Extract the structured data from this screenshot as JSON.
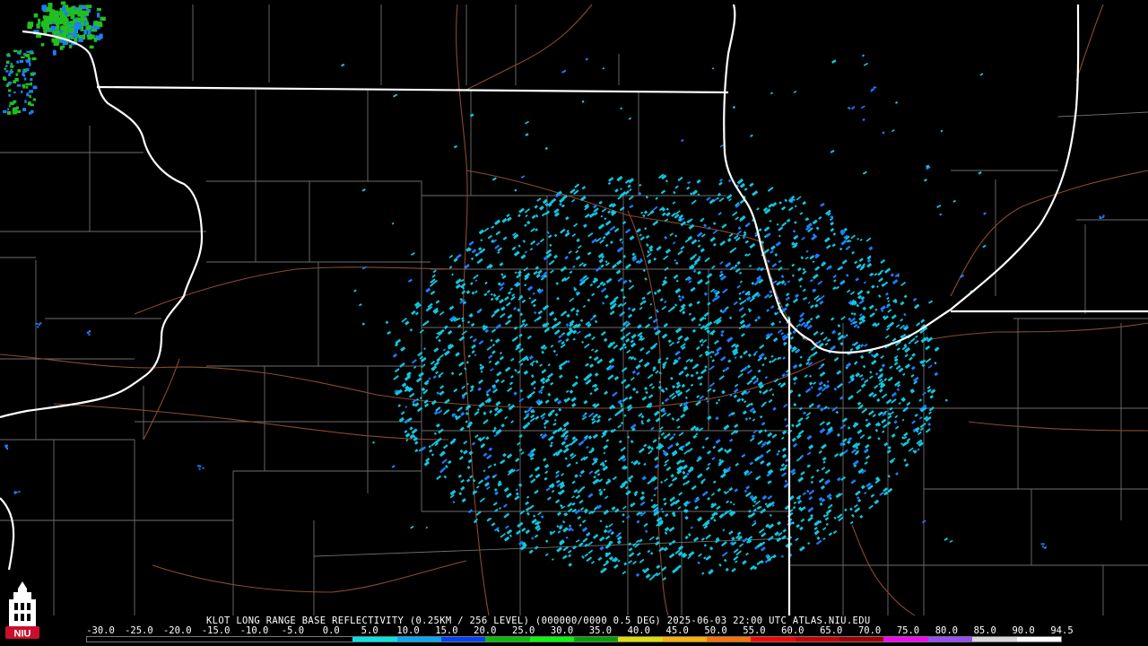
{
  "caption": "KLOT LONG RANGE BASE REFLECTIVITY (0.25KM / 256 LEVEL) (000000/0000 0.5 DEG) 2025-06-03 22:00 UTC  ATLAS.NIU.EDU",
  "logo": {
    "text": "NIU",
    "icon": "niu-tower-logo-icon",
    "color": "#c8102e"
  },
  "scale": {
    "labels": [
      "-30.0",
      "-25.0",
      "-20.0",
      "-15.0",
      "-10.0",
      "-5.0",
      "0.0",
      "5.0",
      "10.0",
      "15.0",
      "20.0",
      "25.0",
      "30.0",
      "35.0",
      "40.0",
      "45.0",
      "50.0",
      "55.0",
      "60.0",
      "65.0",
      "70.0",
      "75.0",
      "80.0",
      "85.0",
      "90.0",
      "94.5"
    ],
    "colors": [
      "#000000",
      "#000000",
      "#000000",
      "#000000",
      "#000000",
      "#000000",
      "#00e6e6",
      "#00aaff",
      "#0040ff",
      "#00c000",
      "#00ff00",
      "#00a000",
      "#dede00",
      "#ffb000",
      "#ff7000",
      "#ff0000",
      "#c80000",
      "#a00000",
      "#ff00ff",
      "#9a4cff",
      "#d8d8d8",
      "#ffffff"
    ]
  },
  "map_colors": {
    "state_border": "#ffffff",
    "county_border": "#6e6e6e",
    "highway": "#8b4a2e",
    "echo_light": "#10c8e0",
    "echo_medium": "#1e7cff",
    "echo_strong": "#20c020"
  }
}
